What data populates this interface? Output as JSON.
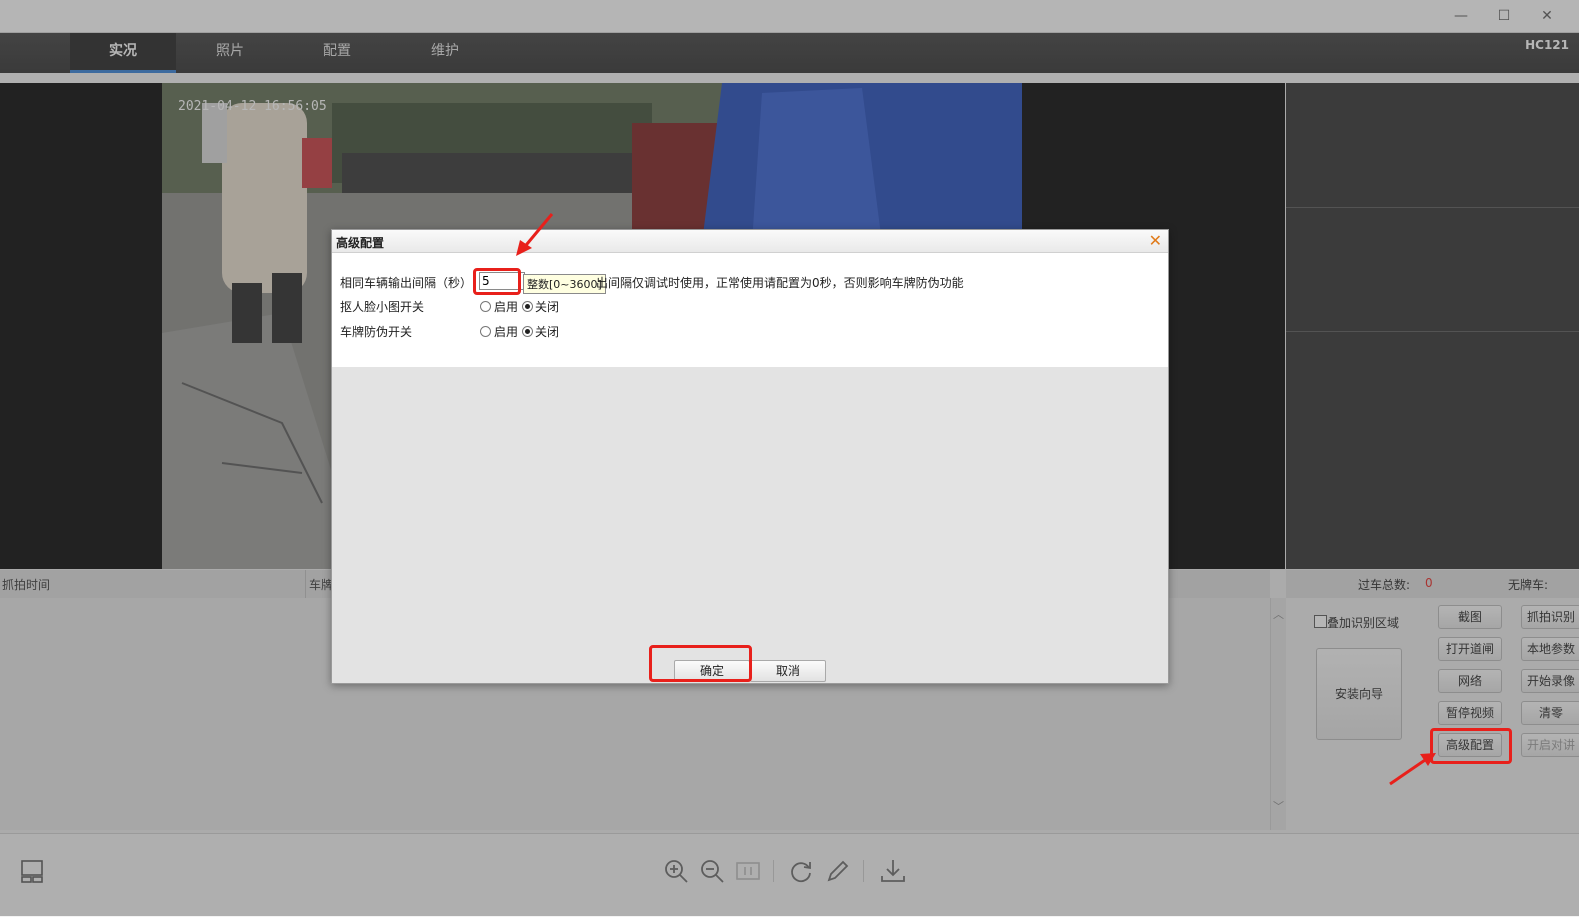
{
  "window": {
    "minimize_glyph": "—",
    "maximize_glyph": "☐",
    "close_glyph": "✕"
  },
  "nav": {
    "tabs": [
      {
        "label": "实况",
        "active": true
      },
      {
        "label": "照片",
        "active": false
      },
      {
        "label": "配置",
        "active": false
      },
      {
        "label": "维护",
        "active": false
      }
    ],
    "device": "HC121"
  },
  "video": {
    "timestamp": "2021-04-12 16:56:05"
  },
  "list": {
    "col_capture_time": "抓拍时间",
    "col_plate": "车牌"
  },
  "stats": {
    "total_label": "过车总数:",
    "total_value": "0",
    "no_plate_label": "无牌车:"
  },
  "controls": {
    "overlay_region_label": "叠加识别区域",
    "install_wizard": "安装向导",
    "col1": [
      "截图",
      "打开道闸",
      "网络",
      "暂停视频",
      "高级配置"
    ],
    "col2": [
      "抓拍识别",
      "本地参数",
      "开始录像",
      "清零",
      "开启对讲"
    ]
  },
  "dialog": {
    "title": "高级配置",
    "close_glyph": "✕",
    "row1_label": "相同车辆输出间隔（秒）",
    "row1_value": "5",
    "row1_tooltip": "整数[0~3600]",
    "row1_note": "出间隔仅调试时使用，正常使用请配置为0秒，否则影响车牌防伪功能",
    "row2_label": "抠人脸小图开关",
    "row3_label": "车牌防伪开关",
    "enable_label": "启用",
    "disable_label": "关闭",
    "ok": "确定",
    "cancel": "取消"
  },
  "colors": {
    "accent": "#2f7fd8",
    "highlight": "#e8201b",
    "stat_value": "#e8201b"
  }
}
